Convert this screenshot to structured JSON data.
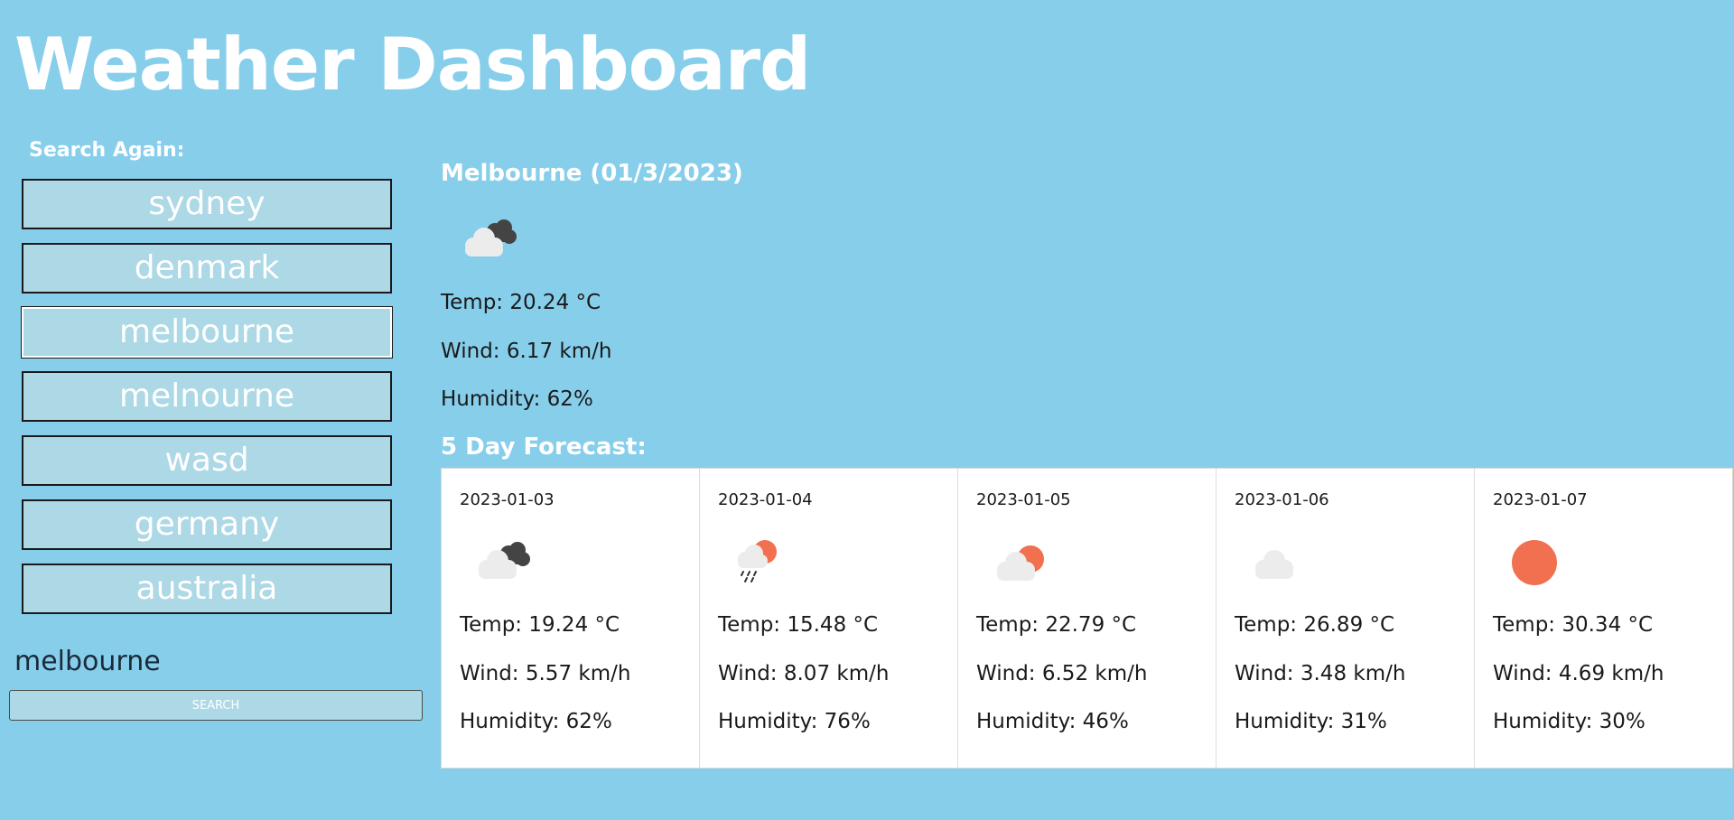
{
  "header": {
    "title": "Weather Dashboard"
  },
  "sidebar": {
    "search_again_label": "Search Again:",
    "history": [
      {
        "label": "sydney"
      },
      {
        "label": "denmark"
      },
      {
        "label": "melbourne"
      },
      {
        "label": "melnourne"
      },
      {
        "label": "wasd"
      },
      {
        "label": "germany"
      },
      {
        "label": "australia"
      }
    ],
    "search_input_value": "melbourne",
    "search_button_label": "SEARCH"
  },
  "current": {
    "title": "Melbourne (01/3/2023)",
    "icon": "cloudy-icon",
    "temp": "Temp: 20.24 °C",
    "wind": "Wind: 6.17 km/h",
    "humidity": "Humidity: 62%"
  },
  "forecast": {
    "title": "5 Day Forecast:",
    "days": [
      {
        "date": "2023-01-03",
        "icon": "cloudy-icon",
        "temp": "Temp: 19.24 °C",
        "wind": "Wind: 5.57 km/h",
        "humidity": "Humidity: 62%"
      },
      {
        "date": "2023-01-04",
        "icon": "rain-sun-icon",
        "temp": "Temp: 15.48 °C",
        "wind": "Wind: 8.07 km/h",
        "humidity": "Humidity: 76%"
      },
      {
        "date": "2023-01-05",
        "icon": "partly-sunny-icon",
        "temp": "Temp: 22.79 °C",
        "wind": "Wind: 6.52 km/h",
        "humidity": "Humidity: 46%"
      },
      {
        "date": "2023-01-06",
        "icon": "cloud-icon",
        "temp": "Temp: 26.89 °C",
        "wind": "Wind: 3.48 km/h",
        "humidity": "Humidity: 31%"
      },
      {
        "date": "2023-01-07",
        "icon": "sun-icon",
        "temp": "Temp: 30.34 °C",
        "wind": "Wind: 4.69 km/h",
        "humidity": "Humidity: 30%"
      }
    ]
  },
  "colors": {
    "background": "#87ceeb",
    "button": "#add8e6",
    "sun": "#f0704f",
    "dark_cloud": "#444444",
    "light_cloud": "#ececec"
  }
}
